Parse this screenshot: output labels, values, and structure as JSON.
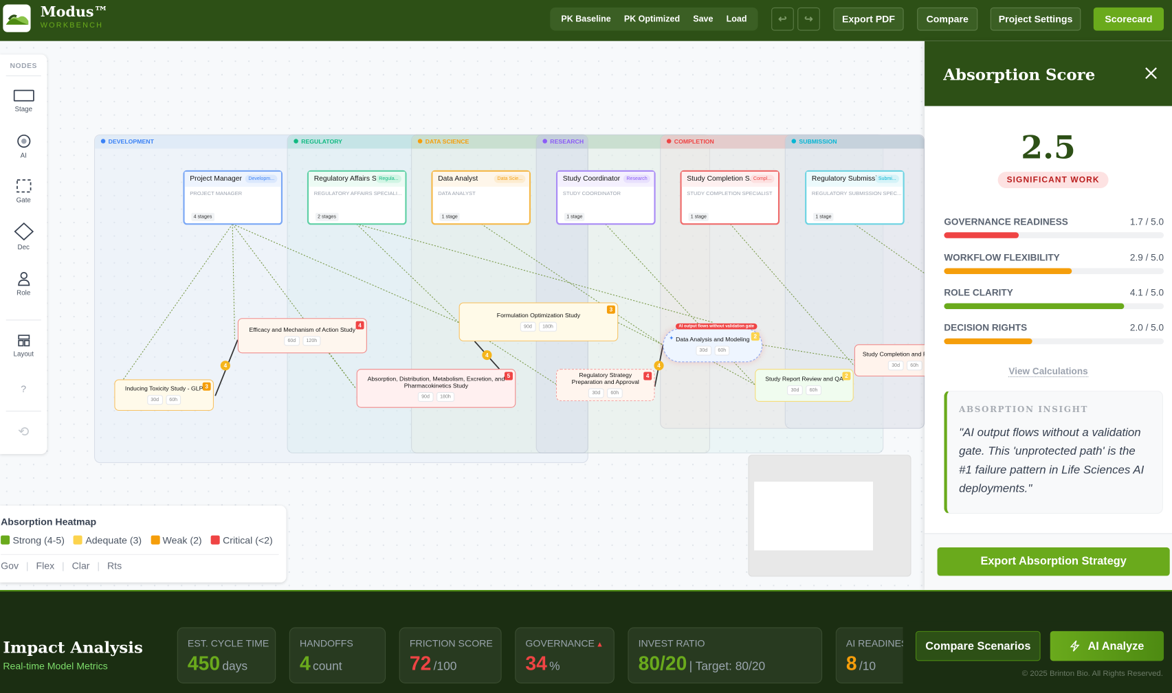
{
  "header": {
    "brand": "Modus™",
    "brand_sub": "WORKBENCH",
    "scenario_buttons": [
      "PK Baseline",
      "PK Optimized",
      "Save",
      "Load"
    ],
    "export_pdf": "Export PDF",
    "compare": "Compare",
    "project_settings": "Project Settings",
    "scorecard": "Scorecard"
  },
  "toolbar": {
    "title": "NODES",
    "items": [
      "Stage",
      "AI",
      "Gate",
      "Dec",
      "Role"
    ],
    "layout": "Layout",
    "help": "?"
  },
  "lanes": [
    "DEVELOPMENT",
    "REGULATORY",
    "DATA SCIENCE",
    "RESEARCH",
    "COMPLETION",
    "SUBMISSION"
  ],
  "roles": [
    {
      "title": "Project Manager",
      "tag": "Developm...",
      "subtitle": "PROJECT MANAGER",
      "count": "4 stages"
    },
    {
      "title": "Regulatory Affairs S...",
      "tag": "Regula...",
      "subtitle": "REGULATORY AFFAIRS SPECIALI...",
      "count": "2 stages"
    },
    {
      "title": "Data Analyst",
      "tag": "Data Scie...",
      "subtitle": "DATA ANALYST",
      "count": "1 stage"
    },
    {
      "title": "Study Coordinator",
      "tag": "Research",
      "subtitle": "STUDY COORDINATOR",
      "count": "1 stage"
    },
    {
      "title": "Study Completion S...",
      "tag": "Compl...",
      "subtitle": "STUDY COMPLETION SPECIALIST",
      "count": "1 stage"
    },
    {
      "title": "Regulatory Submissi...",
      "tag": "Submi...",
      "subtitle": "REGULATORY SUBMISSION SPEC...",
      "count": "1 stage"
    }
  ],
  "stages": [
    {
      "title": "Efficacy and Mechanism of Action Study",
      "days": "60d",
      "hours": "120h",
      "score": "4"
    },
    {
      "title": "Inducing Toxicity Study - GLP",
      "days": "30d",
      "hours": "60h",
      "score": "3"
    },
    {
      "title": "Formulation Optimization Study",
      "days": "90d",
      "hours": "180h",
      "score": "3"
    },
    {
      "title": "Absorption, Distribution, Metabolism, Excretion, and Pharmacokinetics Study",
      "days": "90d",
      "hours": "180h",
      "score": "5"
    },
    {
      "title": "Regulatory Strategy Preparation and Approval",
      "days": "30d",
      "hours": "60h",
      "score": "4"
    },
    {
      "title": "Data Analysis and Modeling",
      "days": "30d",
      "hours": "60h",
      "score": "2",
      "warning": "AI output flows without validation gate"
    },
    {
      "title": "Study Report Review and QA",
      "days": "30d",
      "hours": "60h",
      "score": "2"
    },
    {
      "title": "Study Completion and Fi",
      "days": "30d",
      "hours": "60h"
    }
  ],
  "edge_badges": [
    "4",
    "4",
    "4"
  ],
  "heatmap": {
    "title": "Absorption Heatmap",
    "legend": [
      {
        "label": "Strong (4-5)",
        "color": "#6aaa1c"
      },
      {
        "label": "Adequate (3)",
        "color": "#fcd34d"
      },
      {
        "label": "Weak (2)",
        "color": "#f59e0b"
      },
      {
        "label": "Critical (<2)",
        "color": "#ef4444"
      }
    ],
    "dims": [
      "Gov",
      "Flex",
      "Clar",
      "Rts"
    ]
  },
  "panel": {
    "title": "Absorption Score",
    "score": "2.5",
    "badge": "SIGNIFICANT WORK",
    "metrics": [
      {
        "label": "GOVERNANCE READINESS",
        "value": "1.7 / 5.0",
        "fraction": 0.34,
        "color": "#ef4444"
      },
      {
        "label": "WORKFLOW FLEXIBILITY",
        "value": "2.9 / 5.0",
        "fraction": 0.58,
        "color": "#f59e0b"
      },
      {
        "label": "ROLE CLARITY",
        "value": "4.1 / 5.0",
        "fraction": 0.82,
        "color": "#6aaa1c"
      },
      {
        "label": "DECISION RIGHTS",
        "value": "2.0 / 5.0",
        "fraction": 0.4,
        "color": "#f59e0b"
      }
    ],
    "view_calculations": "View Calculations",
    "insight_title": "ABSORPTION INSIGHT",
    "insight_text": "\"AI output flows without a validation gate. This 'unprotected path' is the #1 failure pattern in Life Sciences AI deployments.\"",
    "export_button": "Export Absorption Strategy"
  },
  "footer": {
    "title": "Impact Analysis",
    "subtitle": "Real-time Model Metrics",
    "cards": [
      {
        "label": "EST. CYCLE TIME",
        "value": "450",
        "unit": "days",
        "color": "#6aaa1c"
      },
      {
        "label": "HANDOFFS",
        "value": "4",
        "unit": "count",
        "color": "#6aaa1c"
      },
      {
        "label": "FRICTION SCORE",
        "value": "72",
        "unit": "/100",
        "color": "#ef4444"
      },
      {
        "label": "GOVERNANCE",
        "value": "34",
        "unit": "%",
        "color": "#ef4444"
      },
      {
        "label": "INVEST RATIO",
        "value": "80/20",
        "unit": "| Target: 80/20",
        "color": "#6aaa1c"
      },
      {
        "label": "AI READINESS",
        "value": "8",
        "unit": "/10",
        "color": "#f59e0b"
      }
    ],
    "compare_scenarios": "Compare Scenarios",
    "ai_analyze": "AI Analyze",
    "copyright": "© 2025 Brinton Bio. All Rights Reserved."
  }
}
